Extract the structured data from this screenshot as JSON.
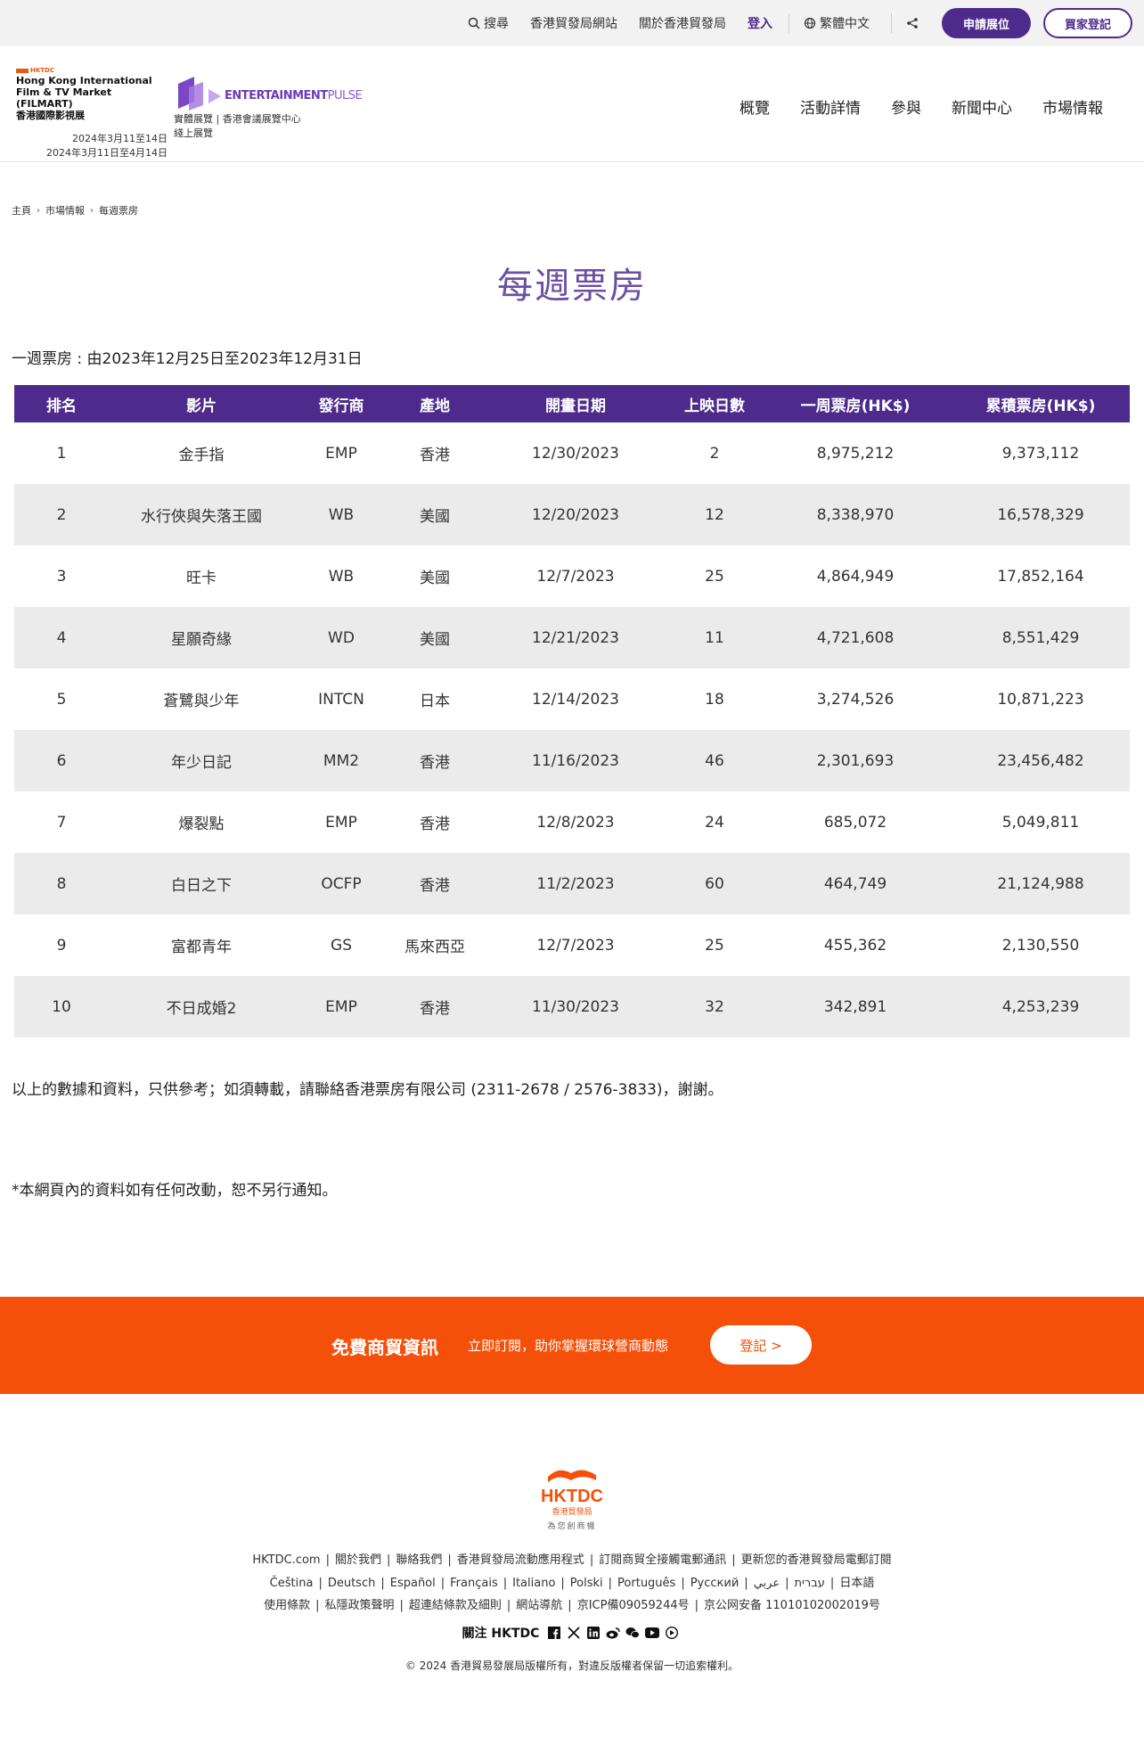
{
  "topbar": {
    "search": "搜尋",
    "hktdc_site": "香港貿發局網站",
    "about": "關於香港貿發局",
    "login": "登入",
    "language": "繁體中文",
    "apply_booth": "申請展位",
    "buyer_register": "買家登記"
  },
  "header": {
    "filmart_brand": "HKTDC",
    "filmart_name_line1": "Hong Kong International",
    "filmart_name_line2": "Film & TV Market (FILMART)",
    "filmart_name_line3": "香港國際影視展",
    "date_physical": "2024年3月11至14日",
    "date_online": "2024年3月11日至4月14日",
    "ep_name_bold": "ENTERTAINMENT",
    "ep_name_thin": "PULSE",
    "venue_physical": "實體展覽 | 香港會議展覽中心",
    "venue_online": "綫上展覽",
    "nav": [
      "概覽",
      "活動詳情",
      "參與",
      "新聞中心",
      "市場情報"
    ]
  },
  "breadcrumb": [
    "主頁",
    "市場情報",
    "每週票房"
  ],
  "page_title": "每週票房",
  "period": "一週票房 : 由2023年12月25日至2023年12月31日",
  "table": {
    "headers": [
      "排名",
      "影片",
      "發行商",
      "產地",
      "開畫日期",
      "上映日數",
      "一周票房(HK$)",
      "累積票房(HK$)"
    ],
    "rows": [
      [
        "1",
        "金手指",
        "EMP",
        "香港",
        "12/30/2023",
        "2",
        "8,975,212",
        "9,373,112"
      ],
      [
        "2",
        "水行俠與失落王國",
        "WB",
        "美國",
        "12/20/2023",
        "12",
        "8,338,970",
        "16,578,329"
      ],
      [
        "3",
        "旺卡",
        "WB",
        "美國",
        "12/7/2023",
        "25",
        "4,864,949",
        "17,852,164"
      ],
      [
        "4",
        "星願奇緣",
        "WD",
        "美國",
        "12/21/2023",
        "11",
        "4,721,608",
        "8,551,429"
      ],
      [
        "5",
        "蒼鷺與少年",
        "INTCN",
        "日本",
        "12/14/2023",
        "18",
        "3,274,526",
        "10,871,223"
      ],
      [
        "6",
        "年少日記",
        "MM2",
        "香港",
        "11/16/2023",
        "46",
        "2,301,693",
        "23,456,482"
      ],
      [
        "7",
        "爆裂點",
        "EMP",
        "香港",
        "12/8/2023",
        "24",
        "685,072",
        "5,049,811"
      ],
      [
        "8",
        "白日之下",
        "OCFP",
        "香港",
        "11/2/2023",
        "60",
        "464,749",
        "21,124,988"
      ],
      [
        "9",
        "富都青年",
        "GS",
        "馬來西亞",
        "12/7/2023",
        "25",
        "455,362",
        "2,130,550"
      ],
      [
        "10",
        "不日成婚2",
        "EMP",
        "香港",
        "11/30/2023",
        "32",
        "342,891",
        "4,253,239"
      ]
    ]
  },
  "note_source": "以上的數據和資料，只供參考；如須轉載，請聯絡香港票房有限公司 (2311-2678 / 2576-3833)，謝謝。",
  "note_disclaimer": "*本網頁內的資料如有任何改動，恕不另行通知。",
  "banner": {
    "title": "免費商貿資訊",
    "desc": "立即訂閱，助你掌握環球營商動態",
    "button": "登記 >"
  },
  "footer": {
    "logo_text": "HKTDC",
    "logo_cn": "香港貿發局",
    "logo_tagline": "為您創商機",
    "row1": [
      "HKTDC.com",
      "關於我們",
      "聯絡我們",
      "香港貿發局流動應用程式",
      "訂閱商貿全接觸電郵通訊",
      "更新您的香港貿發局電郵訂閱"
    ],
    "row2": [
      "Čeština",
      "Deutsch",
      "Español",
      "Français",
      "Italiano",
      "Polski",
      "Português",
      "Русский",
      "עברית",
      "عربي",
      "日本語"
    ],
    "row3": [
      "使用條款",
      "私隱政策聲明",
      "超連結條款及細則",
      "網站導航",
      "京ICP備09059244号",
      "京公网安备 11010102002019号"
    ],
    "follow_label": "關注 HKTDC",
    "social_icons": [
      "facebook-icon",
      "x-icon",
      "linkedin-icon",
      "weibo-icon",
      "wechat-icon",
      "youtube-icon",
      "eye-icon"
    ],
    "copyright": "© 2024  香港貿易發展局版權所有，對違反版權者保留一切追索權利。"
  },
  "colors": {
    "brand_purple": "#4d2b8c",
    "title_purple": "#6a4fa3",
    "banner_orange": "#f5500a",
    "row_stripe": "#ebebeb"
  }
}
